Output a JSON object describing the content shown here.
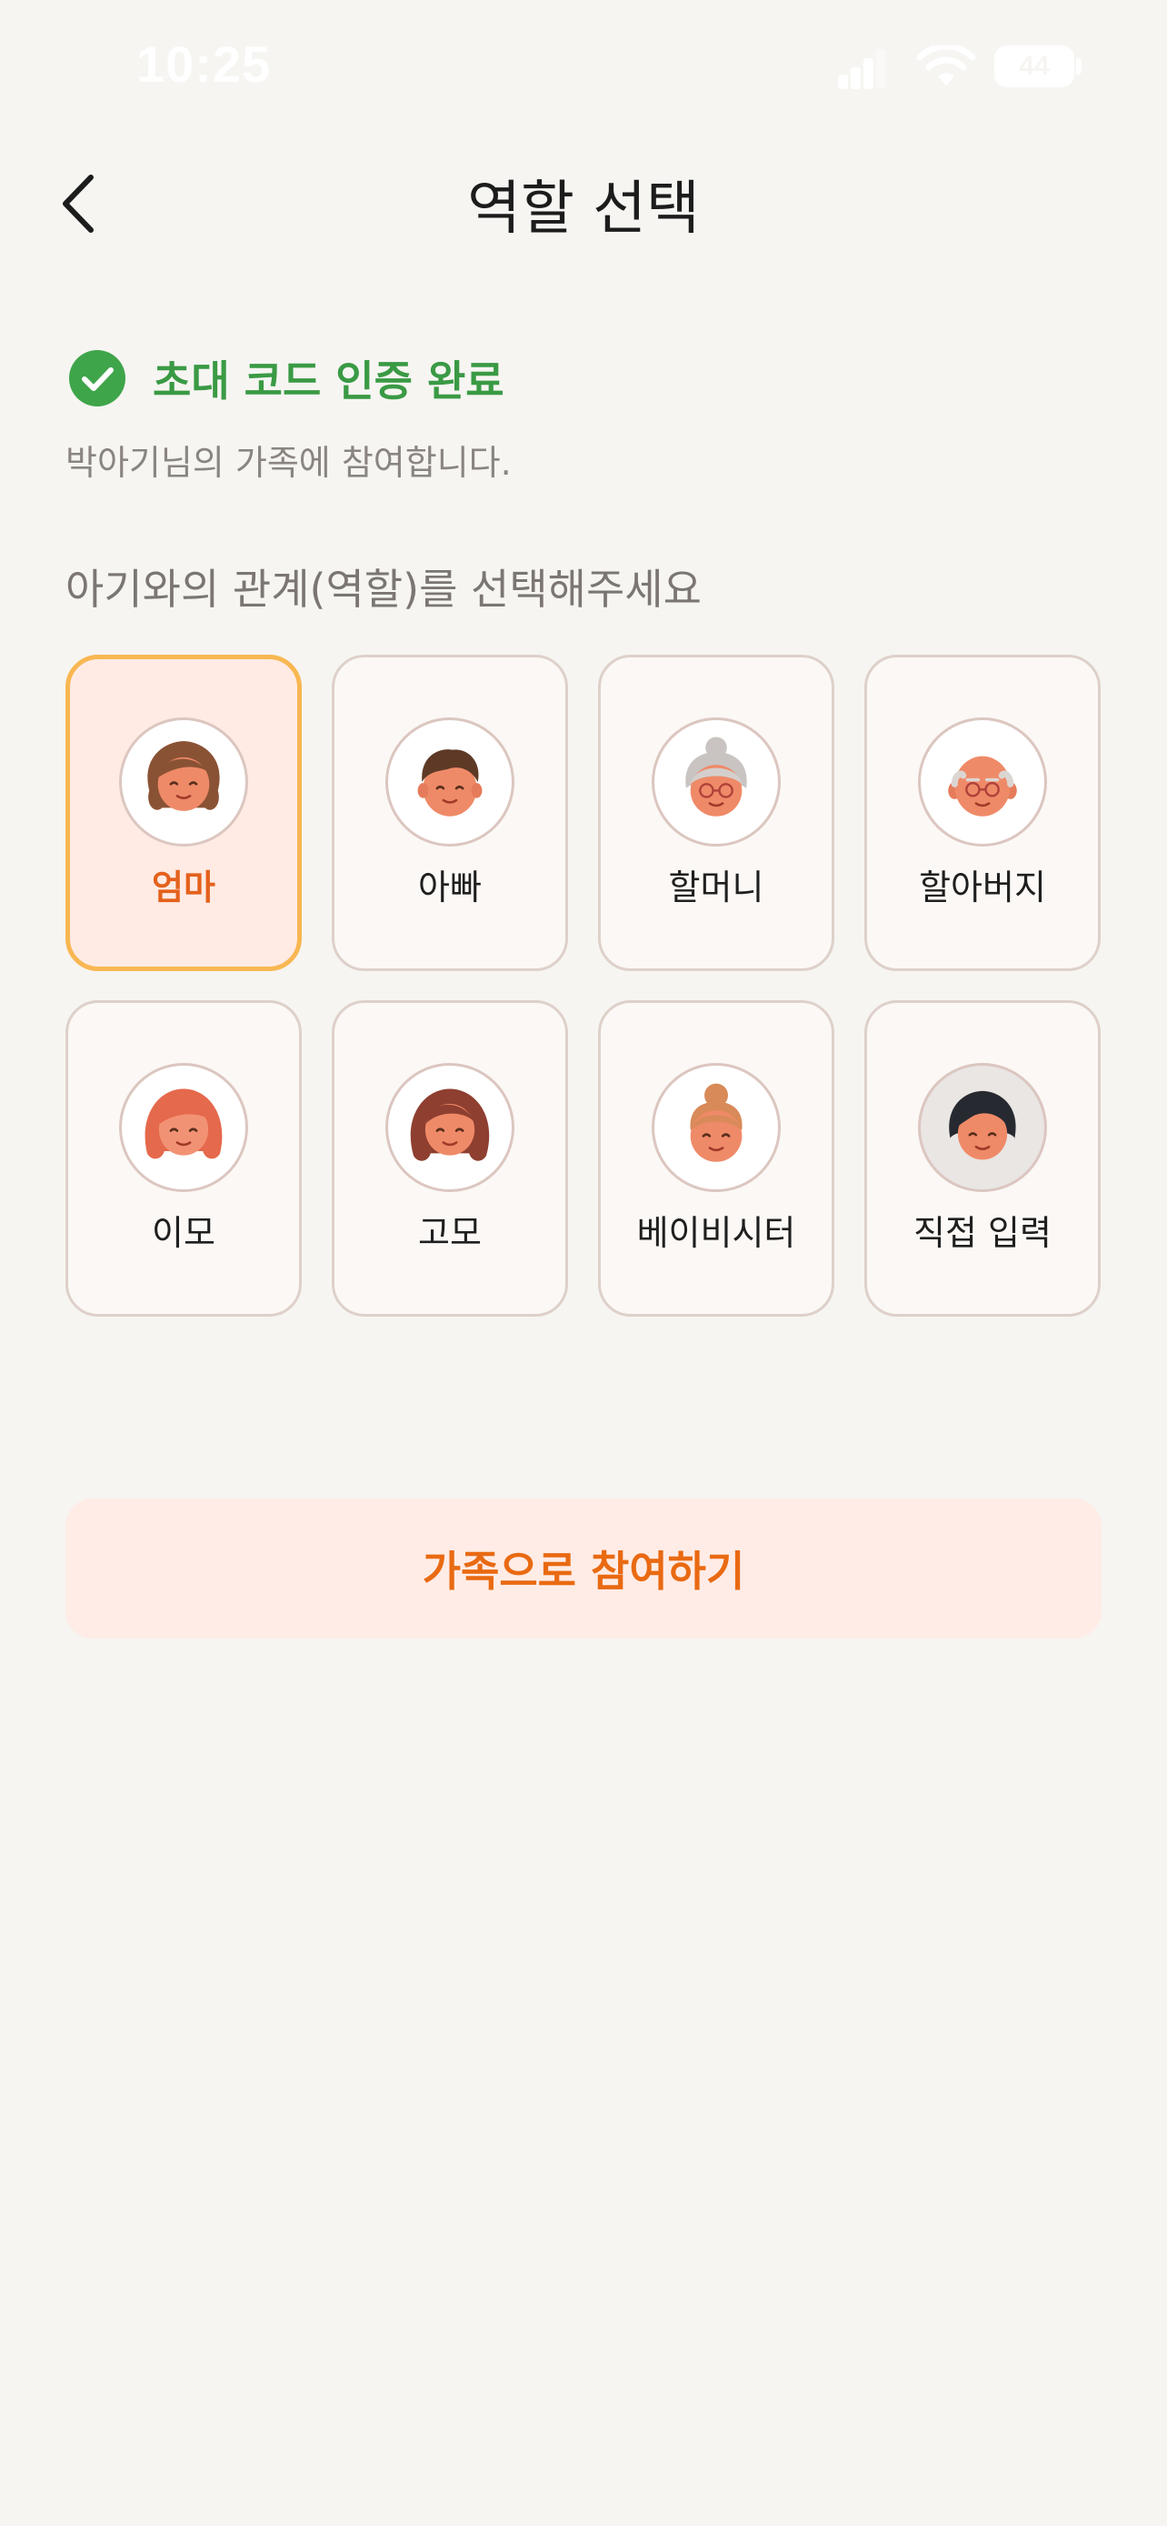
{
  "status_bar": {
    "time": "10:25",
    "battery": "44",
    "colors": {
      "icons": "#ffffff"
    }
  },
  "header": {
    "title": "역할 선택",
    "back_icon": "chevron-left-icon"
  },
  "verification": {
    "icon": "check-circle-icon",
    "title": "초대 코드 인증 완료",
    "subtitle": "박아기님의 가족에 참여합니다.",
    "color": "#3a9a44"
  },
  "role_section": {
    "prompt": "아기와의 관계(역할)를 선택해주세요",
    "selected_index": 0,
    "roles": [
      {
        "label": "엄마",
        "avatar": "mom-avatar-icon",
        "selected": true
      },
      {
        "label": "아빠",
        "avatar": "dad-avatar-icon",
        "selected": false
      },
      {
        "label": "할머니",
        "avatar": "grandma-avatar-icon",
        "selected": false
      },
      {
        "label": "할아버지",
        "avatar": "grandpa-avatar-icon",
        "selected": false
      },
      {
        "label": "이모",
        "avatar": "aunt-maternal-avatar-icon",
        "selected": false
      },
      {
        "label": "고모",
        "avatar": "aunt-paternal-avatar-icon",
        "selected": false
      },
      {
        "label": "베이비시터",
        "avatar": "babysitter-avatar-icon",
        "selected": false
      },
      {
        "label": "직접 입력",
        "avatar": "custom-avatar-icon",
        "selected": false
      }
    ]
  },
  "join_button": {
    "label": "가족으로 참여하기",
    "color": "#e96a12",
    "background": "#ffece6"
  },
  "theme": {
    "background": "#f6f5f2",
    "selected_border": "#f8b752",
    "selected_fill": "#ffebe4",
    "selected_text": "#e4611c"
  }
}
